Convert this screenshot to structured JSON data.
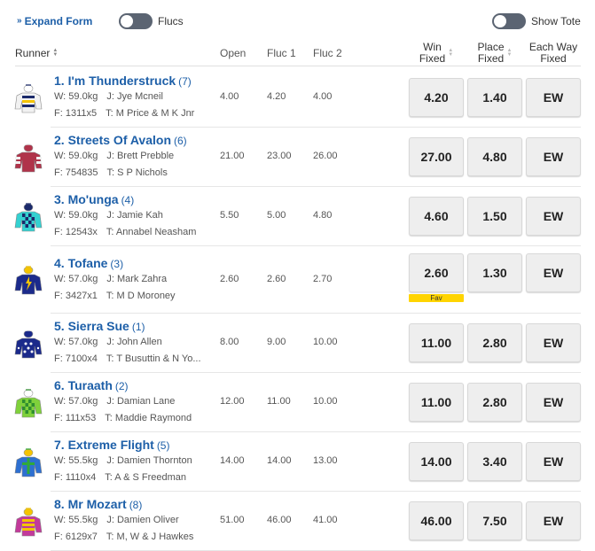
{
  "toolbar": {
    "expand_label": "Expand Form",
    "flucs_label": "Flucs",
    "tote_label": "Show Tote"
  },
  "columns": {
    "runner": "Runner",
    "open": "Open",
    "fluc1": "Fluc 1",
    "fluc2": "Fluc 2",
    "win_l1": "Win",
    "win_l2": "Fixed",
    "place_l1": "Place",
    "place_l2": "Fixed",
    "ew_l1": "Each Way",
    "ew_l2": "Fixed"
  },
  "runners": [
    {
      "name": "1. I'm Thunderstruck",
      "barrier": "(7)",
      "weight": "W: 59.0kg",
      "jockey": "J: Jye Mcneil",
      "form": "F: 1311x5",
      "trainer": "T: M Price & M K Jnr",
      "open": "4.00",
      "fluc1": "4.20",
      "fluc2": "4.00",
      "win": "4.20",
      "place": "1.40",
      "ew": "EW",
      "fav": "",
      "silk": {
        "body": "#f2f2f2",
        "stripe": "#1b2a6b",
        "stripe2": "#f5c400",
        "cap": "#ffffff",
        "pattern": "hoops"
      }
    },
    {
      "name": "2. Streets Of Avalon",
      "barrier": "(6)",
      "weight": "W: 59.0kg",
      "jockey": "J: Brett Prebble",
      "form": "F: 754835",
      "trainer": "T: S P Nichols",
      "open": "21.00",
      "fluc1": "23.00",
      "fluc2": "26.00",
      "win": "27.00",
      "place": "4.80",
      "ew": "EW",
      "fav": "",
      "silk": {
        "body": "#b0334a",
        "stripe": "#f2f2f2",
        "stripe2": "#b0334a",
        "cap": "#b0334a",
        "pattern": "sleeves"
      }
    },
    {
      "name": "3. Mo'unga",
      "barrier": "(4)",
      "weight": "W: 59.0kg",
      "jockey": "J: Jamie Kah",
      "form": "F: 12543x",
      "trainer": "T: Annabel Neasham",
      "open": "5.50",
      "fluc1": "5.00",
      "fluc2": "4.80",
      "win": "4.60",
      "place": "1.50",
      "ew": "EW",
      "fav": "",
      "silk": {
        "body": "#34d1d1",
        "stripe": "#1b2a6b",
        "stripe2": "#34d1d1",
        "cap": "#1b2a6b",
        "pattern": "check"
      }
    },
    {
      "name": "4. Tofane",
      "barrier": "(3)",
      "weight": "W: 57.0kg",
      "jockey": "J: Mark Zahra",
      "form": "F: 3427x1",
      "trainer": "T: M D Moroney",
      "open": "2.60",
      "fluc1": "2.60",
      "fluc2": "2.70",
      "win": "2.60",
      "place": "1.30",
      "ew": "EW",
      "fav": "Fav",
      "silk": {
        "body": "#1b2a8b",
        "stripe": "#f5c400",
        "stripe2": "#1b2a8b",
        "cap": "#f5c400",
        "pattern": "bolt"
      }
    },
    {
      "name": "5. Sierra Sue",
      "barrier": "(1)",
      "weight": "W: 57.0kg",
      "jockey": "J: John Allen",
      "form": "F: 7100x4",
      "trainer": "T: T Busuttin & N Yo...",
      "open": "8.00",
      "fluc1": "9.00",
      "fluc2": "10.00",
      "win": "11.00",
      "place": "2.80",
      "ew": "EW",
      "fav": "",
      "silk": {
        "body": "#1b2a8b",
        "stripe": "#ffffff",
        "stripe2": "#1b2a8b",
        "cap": "#1b2a8b",
        "pattern": "spots"
      }
    },
    {
      "name": "6. Turaath",
      "barrier": "(2)",
      "weight": "W: 57.0kg",
      "jockey": "J: Damian Lane",
      "form": "F: 111x53",
      "trainer": "T: Maddie Raymond",
      "open": "12.00",
      "fluc1": "11.00",
      "fluc2": "10.00",
      "win": "11.00",
      "place": "2.80",
      "ew": "EW",
      "fav": "",
      "silk": {
        "body": "#7fd13b",
        "stripe": "#2f8f2f",
        "stripe2": "#7fd13b",
        "cap": "#ffffff",
        "pattern": "check"
      }
    },
    {
      "name": "7. Extreme Flight",
      "barrier": "(5)",
      "weight": "W: 55.5kg",
      "jockey": "J: Damien Thornton",
      "form": "F: 1110x4",
      "trainer": "T: A & S Freedman",
      "open": "14.00",
      "fluc1": "14.00",
      "fluc2": "13.00",
      "win": "14.00",
      "place": "3.40",
      "ew": "EW",
      "fav": "",
      "silk": {
        "body": "#2d6fd1",
        "stripe": "#2faa3a",
        "stripe2": "#2d6fd1",
        "cap": "#f5c400",
        "pattern": "cross"
      }
    },
    {
      "name": "8. Mr Mozart",
      "barrier": "(8)",
      "weight": "W: 55.5kg",
      "jockey": "J: Damien Oliver",
      "form": "F: 6129x7",
      "trainer": "T: M, W & J Hawkes",
      "open": "51.00",
      "fluc1": "46.00",
      "fluc2": "41.00",
      "win": "46.00",
      "place": "7.50",
      "ew": "EW",
      "fav": "",
      "silk": {
        "body": "#c23a9a",
        "stripe": "#f5c400",
        "stripe2": "#c23a9a",
        "cap": "#f5c400",
        "pattern": "hoops"
      }
    }
  ]
}
